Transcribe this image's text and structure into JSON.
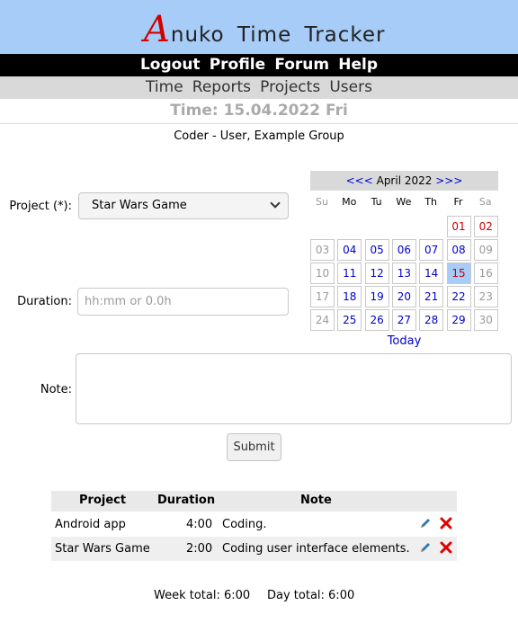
{
  "brand": {
    "first_letter": "A",
    "rest": "nuko Time Tracker"
  },
  "top_menu": [
    "Logout",
    "Profile",
    "Forum",
    "Help"
  ],
  "sub_menu": [
    "Time",
    "Reports",
    "Projects",
    "Users"
  ],
  "page_title": "Time: 15.04.2022 Fri",
  "user_line": "Coder - User, Example Group",
  "form": {
    "project_label": "Project (*):",
    "project_value": "Star Wars Game",
    "duration_label": "Duration:",
    "duration_placeholder": "hh:mm or 0.0h",
    "note_label": "Note:",
    "submit_label": "Submit"
  },
  "calendar": {
    "prev": "<<<",
    "month": "April 2022",
    "next": ">>>",
    "weekdays": [
      "Su",
      "Mo",
      "Tu",
      "We",
      "Th",
      "Fr",
      "Sa"
    ],
    "weeks": [
      [
        "",
        "",
        "",
        "",
        "",
        "01",
        "02"
      ],
      [
        "03",
        "04",
        "05",
        "06",
        "07",
        "08",
        "09"
      ],
      [
        "10",
        "11",
        "12",
        "13",
        "14",
        "15",
        "16"
      ],
      [
        "17",
        "18",
        "19",
        "20",
        "21",
        "22",
        "23"
      ],
      [
        "24",
        "25",
        "26",
        "27",
        "28",
        "29",
        "30"
      ]
    ],
    "selected": "15",
    "today_label": "Today"
  },
  "table": {
    "headers": [
      "Project",
      "Duration",
      "Note"
    ],
    "rows": [
      {
        "project": "Android app",
        "duration": "4:00",
        "note": "Coding."
      },
      {
        "project": "Star Wars Game",
        "duration": "2:00",
        "note": "Coding user interface elements."
      }
    ]
  },
  "totals": {
    "week": "Week total: 6:00",
    "day": "Day total: 6:00"
  },
  "colors": {
    "brand_bg": "#a6ccf7",
    "menu_bg": "#000000",
    "submenu_bg": "#d9d9d9",
    "link": "#0000cc",
    "weekend": "#cc0000",
    "delete": "#e00000",
    "edit": "#2a7ab8"
  }
}
